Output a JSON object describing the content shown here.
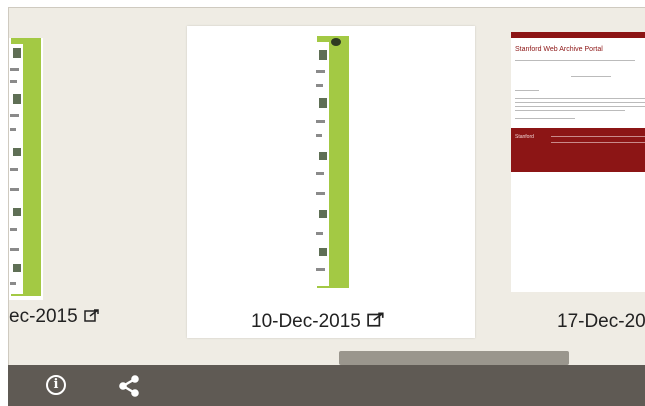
{
  "captures": [
    {
      "date_label": "ec-2015",
      "icon": "external-link-icon"
    },
    {
      "date_label": "10-Dec-2015",
      "icon": "external-link-icon"
    },
    {
      "date_label": "17-Dec-20",
      "icon": "external-link-icon"
    }
  ],
  "stanford_thumb": {
    "title": "Stanford Web Archive Portal",
    "footer_text": "Stanford"
  },
  "toolbar": {
    "info_glyph": "i",
    "info_icon": "info-icon",
    "share_icon": "share-icon"
  },
  "colors": {
    "viewer_bg": "#efece4",
    "toolbar_bg": "#5f5a54",
    "green_strip": "#a3c944",
    "stanford_red": "#8c1515",
    "scrollbar": "#9a968d"
  }
}
